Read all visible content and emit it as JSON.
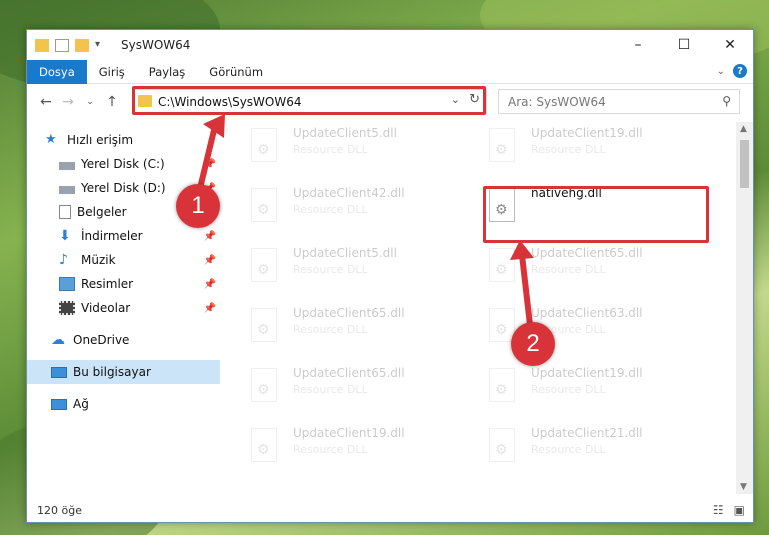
{
  "window": {
    "title": "SysWOW64"
  },
  "titlebar": {
    "minimize": "–",
    "maximize": "☐",
    "close": "✕"
  },
  "ribbon": {
    "tabs": [
      "Dosya",
      "Giriş",
      "Paylaş",
      "Görünüm"
    ],
    "help": "?"
  },
  "address": {
    "path": "C:\\Windows\\SysWOW64"
  },
  "search": {
    "placeholder": "Ara: SysWOW64"
  },
  "sidebar": {
    "items": [
      {
        "label": "Hızlı erişim"
      },
      {
        "label": "Yerel Disk (C:)"
      },
      {
        "label": "Yerel Disk (D:)"
      },
      {
        "label": "Belgeler"
      },
      {
        "label": "İndirmeler"
      },
      {
        "label": "Müzik"
      },
      {
        "label": "Resimler"
      },
      {
        "label": "Videolar"
      },
      {
        "label": "OneDrive"
      },
      {
        "label": "Bu bilgisayar"
      },
      {
        "label": "Ağ"
      }
    ]
  },
  "files": [
    {
      "name": "UpdateClient5.dll",
      "type": "Resource DLL"
    },
    {
      "name": "UpdateClient19.dll",
      "type": "Resource DLL"
    },
    {
      "name": "UpdateClient42.dll",
      "type": "Resource DLL"
    },
    {
      "name": "nativehg.dll",
      "type": ""
    },
    {
      "name": "UpdateClient5.dll",
      "type": "Resource DLL"
    },
    {
      "name": "UpdateClient65.dll",
      "type": "Resource DLL"
    },
    {
      "name": "UpdateClient65.dll",
      "type": "Resource DLL"
    },
    {
      "name": "UpdateClient63.dll",
      "type": "Resource DLL"
    },
    {
      "name": "UpdateClient65.dll",
      "type": "Resource DLL"
    },
    {
      "name": "UpdateClient19.dll",
      "type": "Resource DLL"
    },
    {
      "name": "UpdateClient19.dll",
      "type": "Resource DLL"
    },
    {
      "name": "UpdateClient21.dll",
      "type": "Resource DLL"
    }
  ],
  "status": {
    "count": "120 öğe"
  },
  "annotations": {
    "badge1": "1",
    "badge2": "2",
    "color": "#d9333a"
  }
}
